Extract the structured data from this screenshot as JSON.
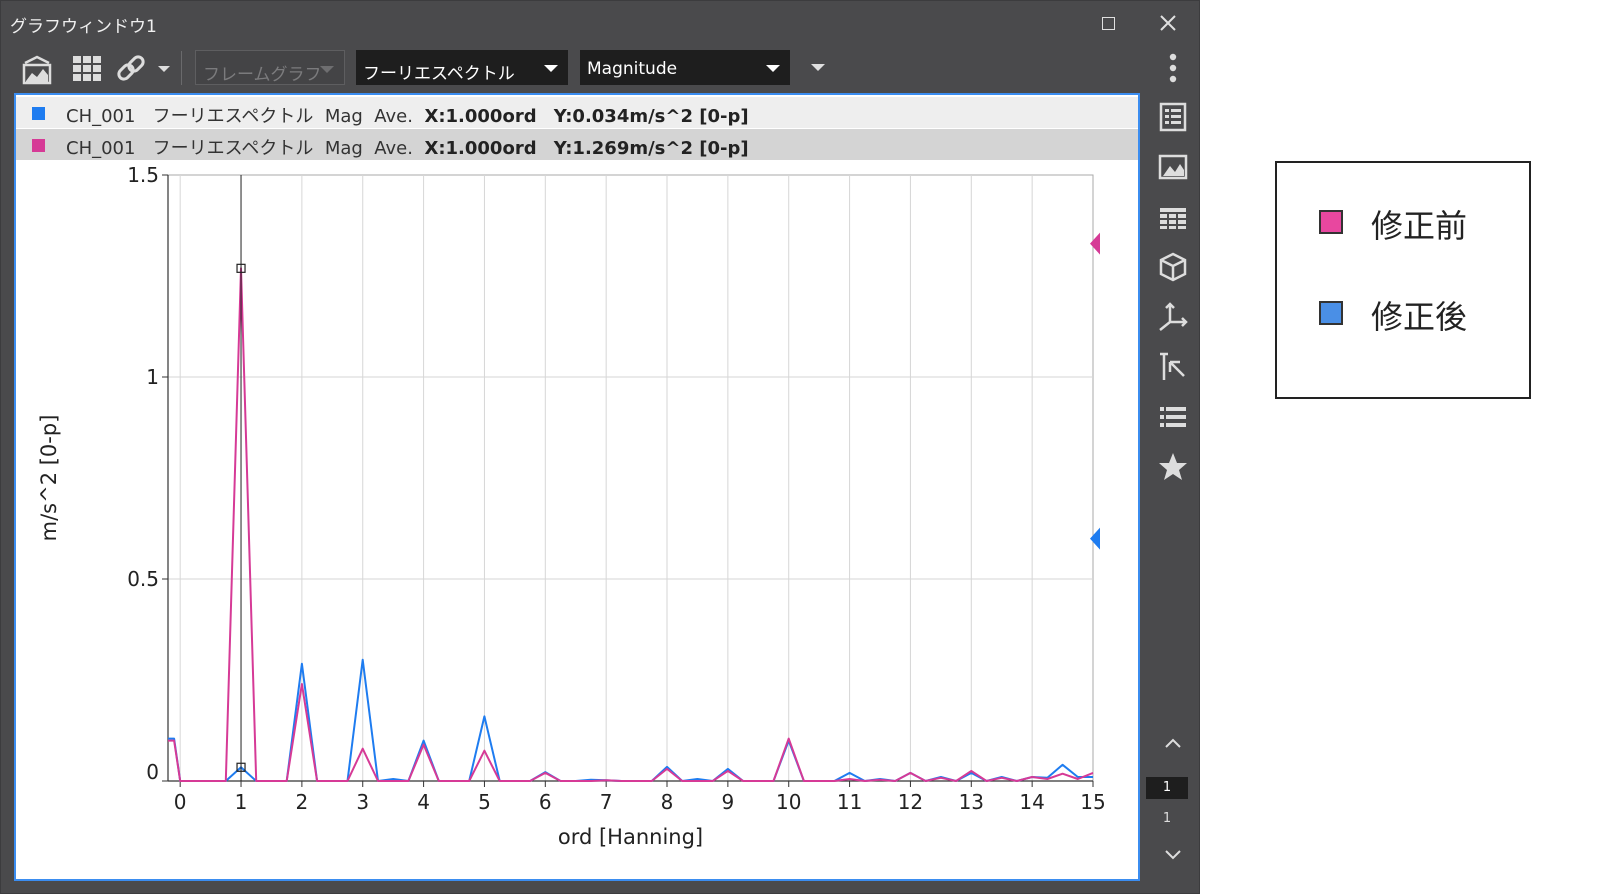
{
  "window": {
    "title": "グラフウィンドウ1"
  },
  "toolbar": {
    "frame_graph": "フレームグラフ",
    "spectrum_type": "フーリエスペクトル",
    "display_mode": "Magnitude"
  },
  "cursor_info": [
    {
      "channel": "CH_001",
      "type": "フーリエスペクトル",
      "stat": "Mag  Ave.",
      "x": "X:1.000ord",
      "y": "Y:0.034m/s^2 [0-p]",
      "color": "#1e7cf0"
    },
    {
      "channel": "CH_001",
      "type": "フーリエスペクトル",
      "stat": "Mag  Ave.",
      "x": "X:1.000ord",
      "y": "Y:1.269m/s^2 [0-p]",
      "color": "#d63a96"
    }
  ],
  "pager": {
    "current": "1",
    "total": "1"
  },
  "legend": {
    "items": [
      {
        "label": "修正前",
        "color": "#e8479f"
      },
      {
        "label": "修正後",
        "color": "#4a8fe6"
      }
    ]
  },
  "chart_data": {
    "type": "line",
    "xlabel": "ord [Hanning]",
    "ylabel": "m/s^2 [0-p]",
    "xlim": [
      -0.2,
      15
    ],
    "ylim": [
      0,
      1.5
    ],
    "x_ticks": [
      "0",
      "1",
      "2",
      "3",
      "4",
      "5",
      "6",
      "7",
      "8",
      "9",
      "10",
      "11",
      "12",
      "13",
      "14",
      "15"
    ],
    "y_ticks": [
      {
        "v": 0,
        "t": "0"
      },
      {
        "v": 0.5,
        "t": "0.5"
      },
      {
        "v": 1,
        "t": "1"
      },
      {
        "v": 1.5,
        "t": "1.5"
      }
    ],
    "cursor_x": 1.0,
    "grid": true,
    "series": [
      {
        "color": "#1e7cf0",
        "x": [
          -0.2,
          -0.1,
          0,
          0.5,
          0.75,
          1,
          1.25,
          1.5,
          1.75,
          2,
          2.25,
          2.5,
          2.75,
          3,
          3.25,
          3.5,
          3.75,
          4,
          4.25,
          4.5,
          4.75,
          5,
          5.25,
          5.5,
          5.75,
          6,
          6.25,
          6.5,
          6.75,
          7,
          7.25,
          7.5,
          7.75,
          8,
          8.25,
          8.5,
          8.75,
          9,
          9.25,
          9.5,
          9.75,
          10,
          10.25,
          10.5,
          10.75,
          11,
          11.25,
          11.5,
          11.75,
          12,
          12.25,
          12.5,
          12.75,
          13,
          13.25,
          13.5,
          13.75,
          14,
          14.25,
          14.5,
          14.75,
          15
        ],
        "y": [
          0.105,
          0.105,
          0,
          0,
          0,
          0.034,
          0,
          0,
          0,
          0.29,
          0,
          0,
          0,
          0.3,
          0,
          0.005,
          0,
          0.1,
          0,
          0,
          0,
          0.16,
          0,
          0,
          0,
          0.022,
          0,
          0,
          0.003,
          0.002,
          0,
          0,
          0,
          0.035,
          0,
          0.005,
          0,
          0.03,
          0,
          0,
          0,
          0.1,
          0,
          0,
          0,
          0.02,
          0,
          0.005,
          0,
          0.02,
          0,
          0.01,
          0,
          0.02,
          0,
          0.01,
          0,
          0.01,
          0.008,
          0.04,
          0.01,
          0.01
        ]
      },
      {
        "color": "#d63a96",
        "x": [
          -0.2,
          -0.1,
          0,
          0.5,
          0.75,
          1,
          1.25,
          1.5,
          1.75,
          2,
          2.25,
          2.5,
          2.75,
          3,
          3.25,
          3.5,
          3.75,
          4,
          4.25,
          4.5,
          4.75,
          5,
          5.25,
          5.5,
          5.75,
          6,
          6.25,
          6.5,
          6.75,
          7,
          7.25,
          7.5,
          7.75,
          8,
          8.25,
          8.5,
          8.75,
          9,
          9.25,
          9.5,
          9.75,
          10,
          10.25,
          10.5,
          10.75,
          11,
          11.25,
          11.5,
          11.75,
          12,
          12.25,
          12.5,
          12.75,
          13,
          13.25,
          13.5,
          13.75,
          14,
          14.25,
          14.5,
          14.75,
          15
        ],
        "y": [
          0.1,
          0.1,
          0,
          0,
          0,
          1.269,
          0,
          0,
          0,
          0.24,
          0,
          0,
          0,
          0.08,
          0,
          0,
          0,
          0.09,
          0,
          0,
          0,
          0.075,
          0,
          0,
          0,
          0.02,
          0,
          0,
          0,
          0.002,
          0,
          0,
          0,
          0.03,
          0,
          0,
          0,
          0.025,
          0,
          0,
          0,
          0.105,
          0,
          0,
          0,
          0.005,
          0,
          0.003,
          0,
          0.02,
          0,
          0.008,
          0,
          0.025,
          0,
          0.008,
          0,
          0.01,
          0.005,
          0.018,
          0.005,
          0.02
        ]
      }
    ]
  }
}
